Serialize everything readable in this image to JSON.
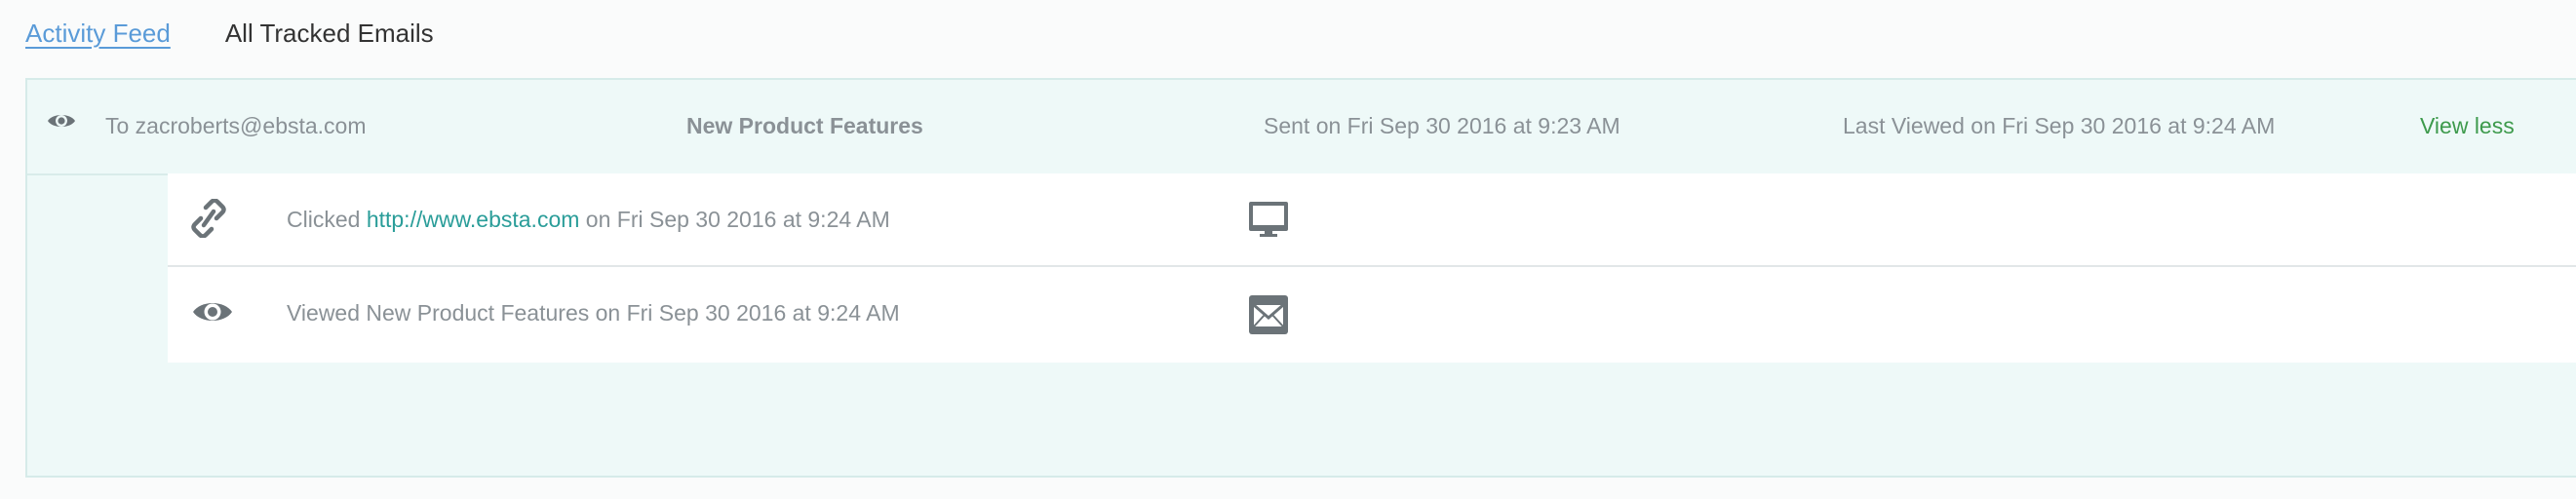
{
  "tabs": [
    {
      "label": "Activity Feed",
      "active": true
    },
    {
      "label": "All Tracked Emails",
      "active": false
    }
  ],
  "email": {
    "to": "To zacroberts@ebsta.com",
    "subject": "New Product Features",
    "sent": "Sent on Fri Sep 30 2016 at 9:23 AM",
    "last_viewed": "Last Viewed on Fri Sep 30 2016 at 9:24 AM",
    "toggle_label": "View less",
    "status_icon": "eye-icon"
  },
  "events": [
    {
      "type": "click",
      "icon": "link-icon",
      "prefix": "Clicked ",
      "link": "http://www.ebsta.com",
      "suffix": " on Fri Sep 30 2016 at 9:24 AM",
      "device_icon": "desktop-icon"
    },
    {
      "type": "view",
      "icon": "eye-icon",
      "text": "Viewed New Product Features on Fri Sep 30 2016 at 9:24 AM",
      "device_icon": "email-client-icon"
    }
  ],
  "colors": {
    "tab_active": "#5a9bd8",
    "panel_bg": "#eef9f8",
    "link": "#2a9d99",
    "view_less": "#3d9a4c",
    "muted_text": "#8a9196",
    "icon": "#6b7378"
  }
}
